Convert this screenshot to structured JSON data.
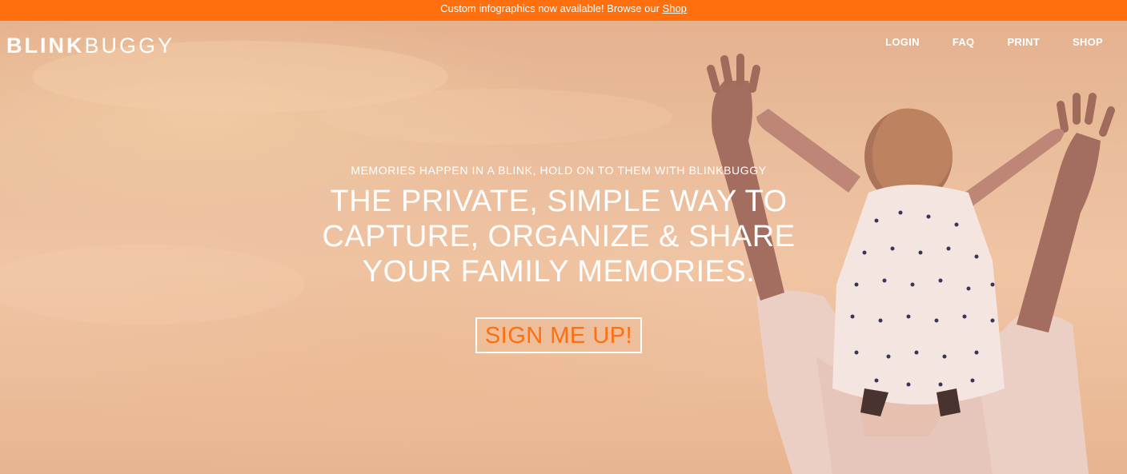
{
  "announcement": {
    "text": "Custom infographics now available! Browse our ",
    "link": "Shop"
  },
  "header": {
    "logo_bold": "BLINK",
    "logo_light": "BUGGY",
    "nav": [
      "LOGIN",
      "FAQ",
      "PRINT",
      "SHOP"
    ]
  },
  "hero": {
    "tagline": "MEMORIES HAPPEN IN A BLINK, HOLD ON TO THEM WITH BLINKBUGGY",
    "headline_lines": [
      "THE PRIVATE, SIMPLE WAY TO",
      "CAPTURE, ORGANIZE & SHARE",
      "YOUR FAMILY MEMORIES."
    ],
    "cta_label": "SIGN ME UP!"
  },
  "colors": {
    "accent": "#ff6f0d",
    "hero_background": "#e8b996",
    "text_light": "#ffffff"
  }
}
